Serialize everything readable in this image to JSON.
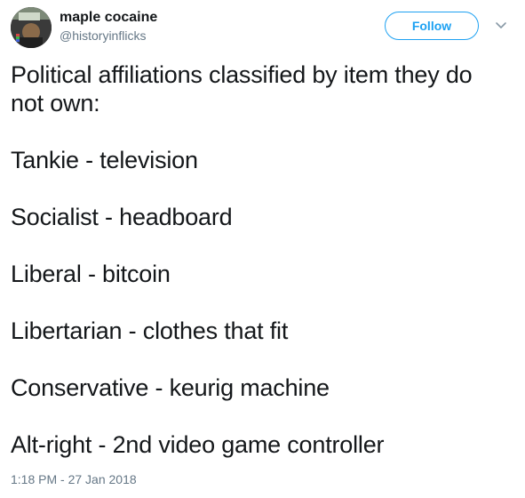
{
  "user": {
    "display_name": "maple cocaine",
    "handle": "@historyinflicks",
    "avatar_icon": "profile-photo"
  },
  "actions": {
    "follow_label": "Follow",
    "more_icon": "chevron-down-icon"
  },
  "tweet": {
    "intro_line1": "Political affiliations classified by item they do",
    "intro_line2": "not own:",
    "items": [
      "Tankie - television",
      "Socialist - headboard",
      "Liberal - bitcoin",
      "Libertarian - clothes that fit",
      "Conservative - keurig machine",
      "Alt-right - 2nd video game controller"
    ],
    "timestamp": "1:18 PM - 27 Jan 2018"
  },
  "colors": {
    "accent": "#1da1f2",
    "text": "#14171a",
    "secondary_text": "#657786"
  }
}
